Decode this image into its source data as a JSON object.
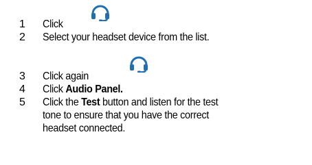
{
  "steps": [
    {
      "number": "1",
      "text": "Click",
      "icon": "headset-icon"
    },
    {
      "number": "2",
      "text": "Select your headset device from the list."
    },
    {
      "number": "3",
      "text": "Click again",
      "icon": "headset-icon"
    },
    {
      "number": "4",
      "prefix": "Click ",
      "bold": "Audio Panel."
    },
    {
      "number": "5",
      "prefix": "Click the ",
      "bold": "Test",
      "suffix": " button and listen for the test tone to ensure that you have the correct headset connected."
    }
  ],
  "colors": {
    "icon": "#1f6fb2",
    "text": "#000000"
  }
}
